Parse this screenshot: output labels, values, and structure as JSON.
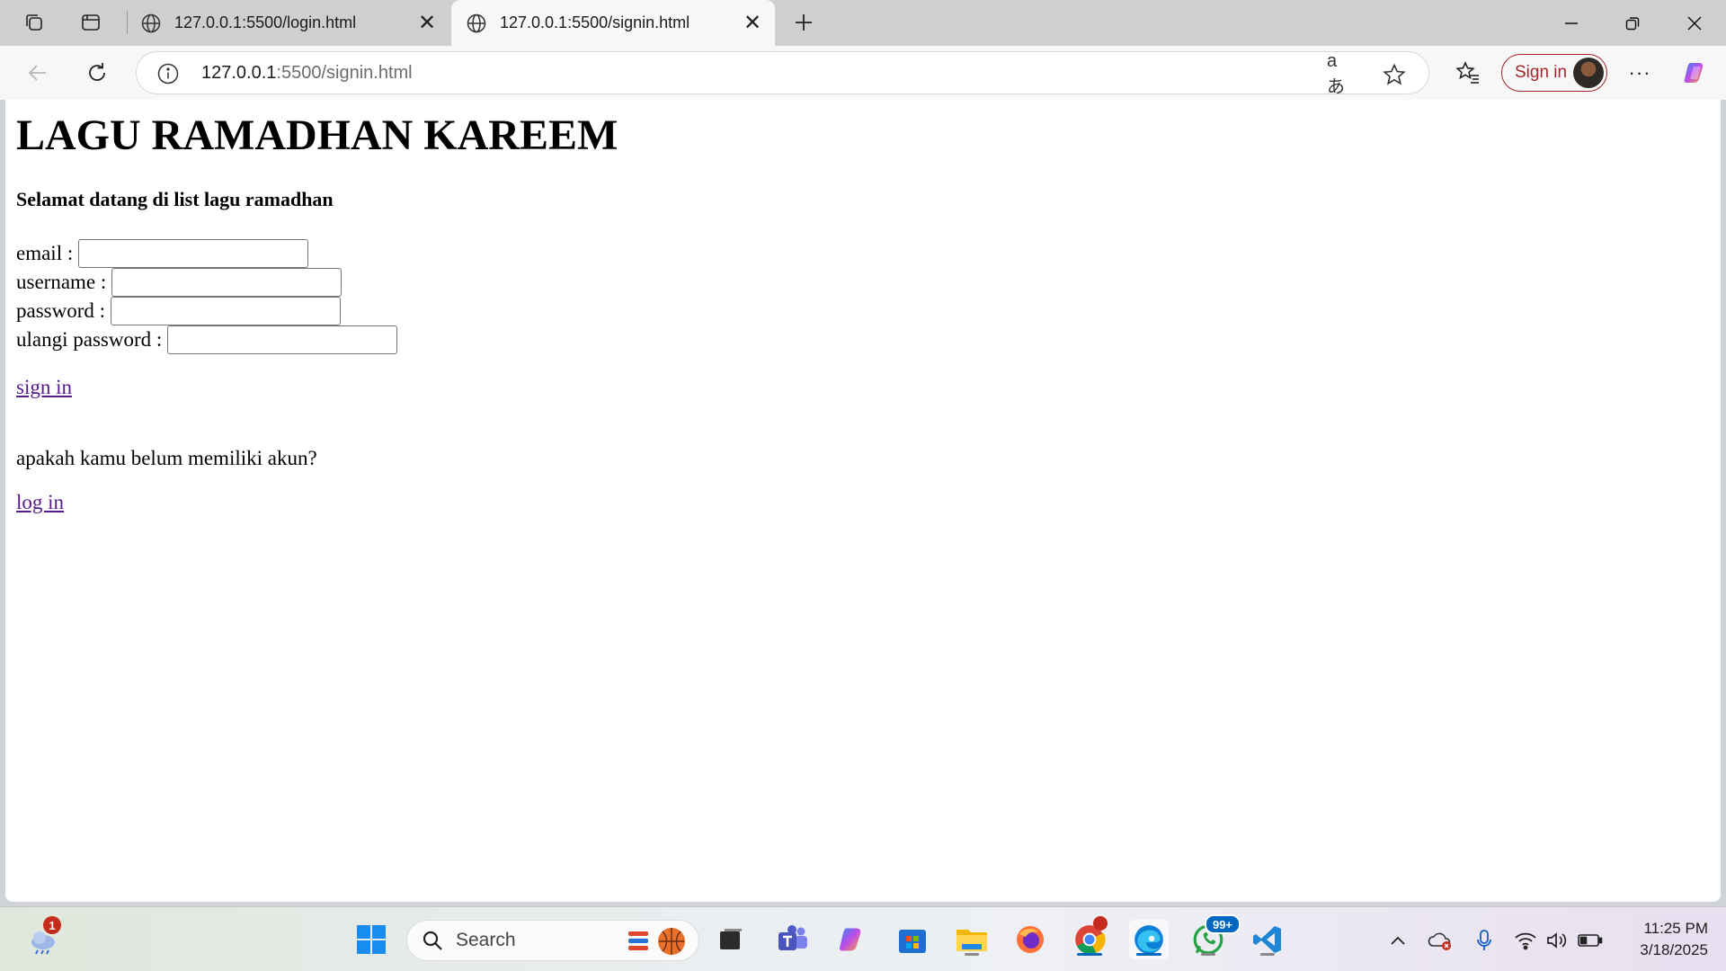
{
  "browser": {
    "tabs": [
      {
        "title": "127.0.0.1:5500/login.html",
        "active": false
      },
      {
        "title": "127.0.0.1:5500/signin.html",
        "active": true
      }
    ],
    "address": {
      "host": "127.0.0.1",
      "path": ":5500/signin.html"
    },
    "profile_label": "Sign in",
    "icons": {
      "workspaces": "workspaces-icon",
      "tab_actions": "tab-actions-icon",
      "back": "back-arrow-icon",
      "reload": "reload-icon",
      "site_info": "info-icon",
      "translate": "translate-icon",
      "favorite": "star-icon",
      "favorites_hub": "favorites-icon",
      "more": "more-icon",
      "copilot": "copilot-icon"
    }
  },
  "page": {
    "heading": "LAGU RAMADHAN KAREEM",
    "welcome": "Selamat datang di list lagu ramadhan",
    "fields": [
      {
        "label": "email :",
        "value": ""
      },
      {
        "label": "username :",
        "value": ""
      },
      {
        "label": "password :",
        "value": ""
      },
      {
        "label": "ulangi password :",
        "value": ""
      }
    ],
    "signin_link": "sign in",
    "no_account_text": "apakah kamu belum memiliki akun?",
    "login_link": "log in",
    "link_color": "#551a8b"
  },
  "taskbar": {
    "search_placeholder": "Search",
    "weather_badge": "1",
    "whatsapp_badge": "99+",
    "time": "11:25 PM",
    "date": "3/18/2025",
    "apps": [
      "start-icon",
      "widgets-icon",
      "task-view-icon",
      "teams-icon",
      "copilot-icon",
      "store-icon",
      "file-explorer-icon",
      "firefox-icon",
      "chrome-icon",
      "edge-icon",
      "whatsapp-icon",
      "vscode-icon"
    ]
  }
}
